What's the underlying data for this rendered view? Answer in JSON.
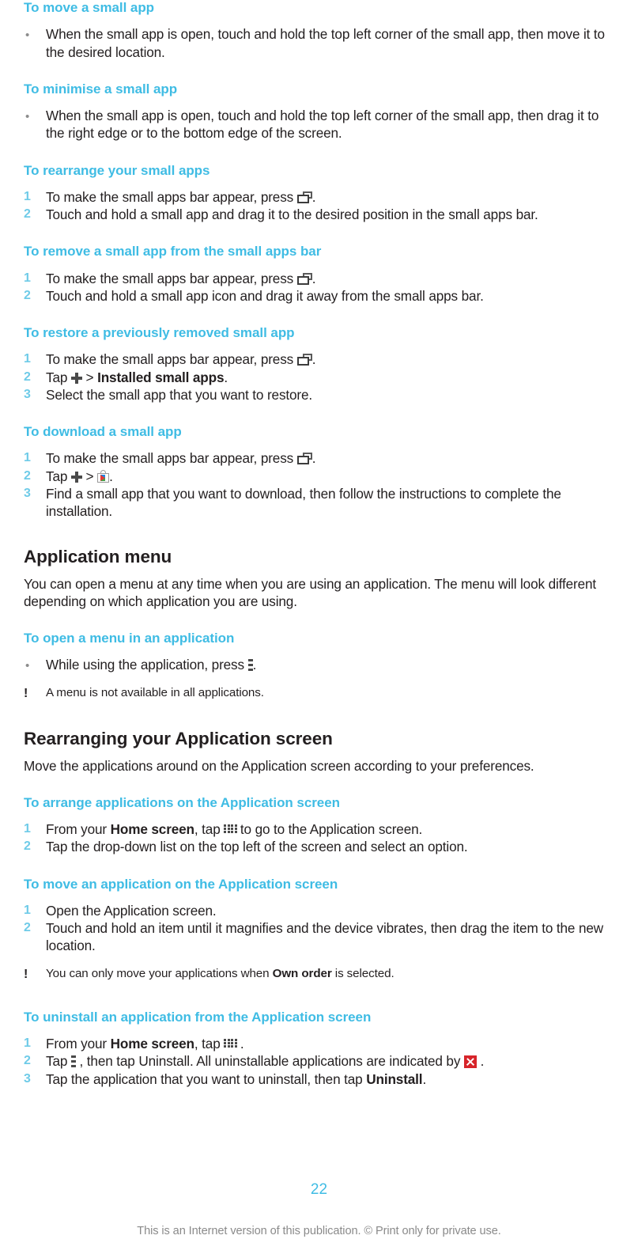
{
  "document": {
    "page_number": "22",
    "footer_note": "This is an Internet version of this publication. © Print only for private use.",
    "heading_color": "#3fbce4",
    "body_color": "#231f20",
    "number_color": "#6fcbe8",
    "badge_color": "#d7242a"
  },
  "procedures": {
    "move_small_app": {
      "title": "To move a small app",
      "steps": [
        "When the small app is open, touch and hold the top left corner of the small app, then move it to the desired location."
      ]
    },
    "minimise_small_app": {
      "title": "To minimise a small app",
      "steps": [
        "When the small app is open, touch and hold the top left corner of the small app, then drag it to the right edge or to the bottom edge of the screen."
      ]
    },
    "rearrange_small_apps": {
      "title": "To rearrange your small apps",
      "step1_pre": "To make the small apps bar appear, press",
      "step1_post": ".",
      "step2": "Touch and hold a small app and drag it to the desired position in the small apps bar."
    },
    "remove_small_app": {
      "title": "To remove a small app from the small apps bar",
      "step1_pre": "To make the small apps bar appear, press",
      "step1_post": ".",
      "step2": "Touch and hold a small app icon and drag it away from the small apps bar."
    },
    "restore_small_app": {
      "title": "To restore a previously removed small app",
      "step1_pre": "To make the small apps bar appear, press",
      "step1_post": ".",
      "step2_pre": "Tap",
      "step2_gt": ">",
      "step2_bold": "Installed small apps",
      "step2_post": ".",
      "step3": "Select the small app that you want to restore."
    },
    "download_small_app": {
      "title": "To download a small app",
      "step1_pre": "To make the small apps bar appear, press",
      "step1_post": ".",
      "step2_pre": "Tap",
      "step2_gt": ">",
      "step2_post": ".",
      "step3": "Find a small app that you want to download, then follow the instructions to complete the installation."
    },
    "open_menu": {
      "title": "To open a menu in an application",
      "step1_pre": "While using the application, press",
      "step1_post": "."
    },
    "arrange_applications": {
      "title": "To arrange applications on the Application screen",
      "step1_pre": "From your",
      "step1_bold": "Home screen",
      "step1_mid": ", tap",
      "step1_post": "to go to the Application screen.",
      "step2": "Tap the drop-down list on the top left of the screen and select an option."
    },
    "move_application": {
      "title": "To move an application on the Application screen",
      "step1": "Open the Application screen.",
      "step2": "Touch and hold an item until it magnifies and the device vibrates, then drag the item to the new location."
    },
    "uninstall_application": {
      "title": "To uninstall an application from the Application screen",
      "step1_pre": "From your",
      "step1_bold": "Home screen",
      "step1_mid": ", tap",
      "step1_post": ".",
      "step2_pre": "Tap",
      "step2_mid": ", then tap",
      "step2_bold": "Uninstall",
      "step2_mid2": ". All uninstallable applications are indicated by",
      "step2_post": ".",
      "step3_pre": "Tap the application that you want to uninstall, then tap",
      "step3_bold": "Uninstall",
      "step3_post": "."
    }
  },
  "sections": {
    "application_menu": {
      "title": "Application menu",
      "intro": "You can open a menu at any time when you are using an application. The menu will look different depending on which application you are using.",
      "note": "A menu is not available in all applications."
    },
    "rearranging_application_screen": {
      "title": "Rearranging your Application screen",
      "intro": "Move the applications around on the Application screen according to your preferences.",
      "note_pre": "You can only move your applications when",
      "note_bold": "Own order",
      "note_post": "is selected."
    }
  },
  "icons": {
    "recent_apps": "recent-apps-icon",
    "plus": "plus-icon",
    "play_store": "play-store-icon",
    "overflow_menu": "overflow-menu-icon",
    "app_drawer_grid": "app-drawer-grid-icon",
    "uninstall_badge": "uninstall-x-badge-icon"
  },
  "markers": {
    "num1": "1",
    "num2": "2",
    "num3": "3",
    "note": "!"
  }
}
